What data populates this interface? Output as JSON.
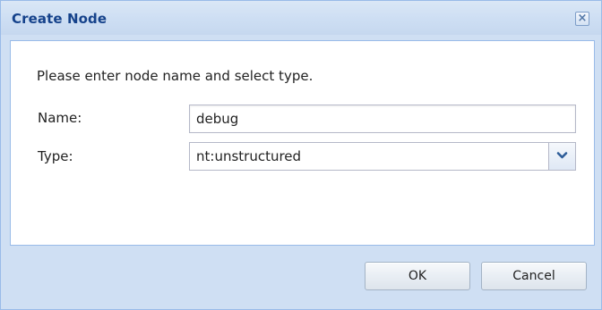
{
  "dialog": {
    "title": "Create Node",
    "close_glyph": "×",
    "intro_text": "Please enter node name and select type.",
    "fields": {
      "name": {
        "label": "Name:",
        "value": "debug"
      },
      "type": {
        "label": "Type:",
        "selected": "nt:unstructured"
      }
    },
    "buttons": {
      "ok_label": "OK",
      "cancel_label": "Cancel"
    }
  },
  "colors": {
    "title_text": "#15428b",
    "frame_background": "#cfdff3",
    "frame_border": "#99bbe8"
  },
  "icons": {
    "close": "close-icon",
    "dropdown": "chevron-down-icon"
  }
}
